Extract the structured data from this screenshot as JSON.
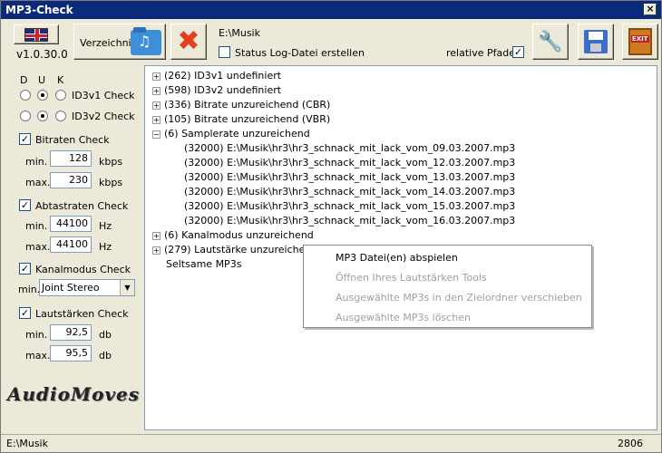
{
  "window": {
    "title": "MP3-Check",
    "close_glyph": "×"
  },
  "toolbar": {
    "version": "v1.0.30.0",
    "directory_label": "Verzeichnis",
    "current_path": "E:\\Musik",
    "status_log_label": "Status Log-Datei erstellen",
    "relative_paths_label": "relative Pfade",
    "relative_paths_checked": "✓"
  },
  "left": {
    "col_d": "D",
    "col_u": "U",
    "col_k": "K",
    "id3v1_label": "ID3v1 Check",
    "id3v2_label": "ID3v2 Check",
    "bitrate_label": "Bitraten Check",
    "bitrate_min_label": "min.",
    "bitrate_min": "128",
    "bitrate_unit": "kbps",
    "bitrate_max_label": "max.",
    "bitrate_max": "230",
    "sample_label": "Abtastraten Check",
    "sample_min_label": "min.",
    "sample_min": "44100",
    "sample_unit": "Hz",
    "sample_max_label": "max.",
    "sample_max": "44100",
    "channel_label": "Kanalmodus Check",
    "channel_min_label": "min.",
    "channel_value": "Joint Stereo",
    "loud_label": "Lautstärken Check",
    "loud_min_label": "min.",
    "loud_min": "92,5",
    "loud_unit": "db",
    "loud_max_label": "max.",
    "loud_max": "95,5",
    "logo": "AudioMoves",
    "check_glyph": "✓"
  },
  "tree": {
    "nodes": [
      "(262) ID3v1 undefiniert",
      "(598) ID3v2 undefiniert",
      "(336) Bitrate unzureichend (CBR)",
      "(105) Bitrate unzureichend (VBR)",
      "(6) Samplerate unzureichend"
    ],
    "children": [
      "(32000) E:\\Musik\\hr3\\hr3_schnack_mit_lack_vom_09.03.2007.mp3",
      "(32000) E:\\Musik\\hr3\\hr3_schnack_mit_lack_vom_12.03.2007.mp3",
      "(32000) E:\\Musik\\hr3\\hr3_schnack_mit_lack_vom_13.03.2007.mp3",
      "(32000) E:\\Musik\\hr3\\hr3_schnack_mit_lack_vom_14.03.2007.mp3",
      "(32000) E:\\Musik\\hr3\\hr3_schnack_mit_lack_vom_15.03.2007.mp3",
      "(32000) E:\\Musik\\hr3\\hr3_schnack_mit_lack_vom_16.03.2007.mp3"
    ],
    "after": [
      "(6) Kanalmodus unzureichend",
      "(279) Lautstärke unzureichend"
    ],
    "odd": "Seltsame MP3s",
    "plus_glyph": "+",
    "minus_glyph": "−"
  },
  "context_menu": {
    "items": [
      "MP3 Datei(en) abspielen",
      "Öffnen Ihres Lautstärken Tools",
      "Ausgewählte MP3s in den Zielordner verschieben",
      "Ausgewählte MP3s löschen"
    ]
  },
  "status": {
    "path": "E:\\Musik",
    "count": "2806"
  }
}
